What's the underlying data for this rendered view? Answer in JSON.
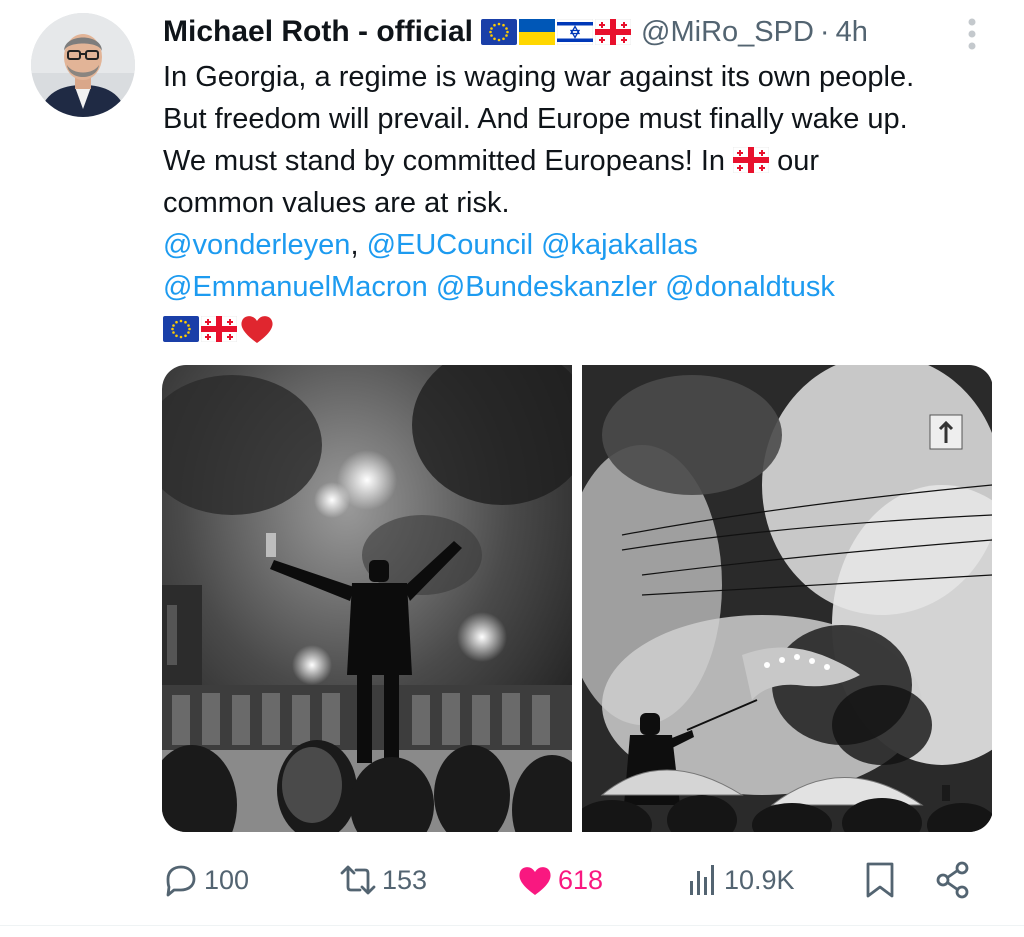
{
  "author": {
    "display_name": "Michael Roth - official",
    "handle": "@MiRo_SPD",
    "separator": "·",
    "time": "4h"
  },
  "header_flags": [
    "EU flag",
    "Ukraine flag",
    "Israel flag",
    "Georgia flag"
  ],
  "text": {
    "line1": "In Georgia, a regime is waging war against its own people.",
    "line2": "But freedom will prevail. And Europe must finally wake up.",
    "line3_before": "We must stand by committed Europeans! In ",
    "line3_after": " our",
    "line4": "common values are at risk.",
    "mention_vonderleyen": "@vonderleyen",
    "comma": ",",
    "mention_eucouncil": "@EUCouncil",
    "mention_kajakallas": "@kajakallas",
    "mention_macron": "@EmmanuelMacron",
    "mention_bundeskanzler": "@Bundeskanzler",
    "mention_tusk": "@donaldtusk"
  },
  "emoji_row": [
    "EU flag",
    "Georgia flag",
    "red heart"
  ],
  "media": [
    {
      "description_icon": "protest-photo-raised-arms"
    },
    {
      "description_icon": "protest-photo-eu-flag-smoke"
    }
  ],
  "actions": {
    "replies": "100",
    "reposts": "153",
    "likes": "618",
    "views": "10.9K"
  },
  "colors": {
    "link": "#1d9bf0",
    "muted": "#536471",
    "like": "#f91880",
    "text": "#0f1419"
  }
}
